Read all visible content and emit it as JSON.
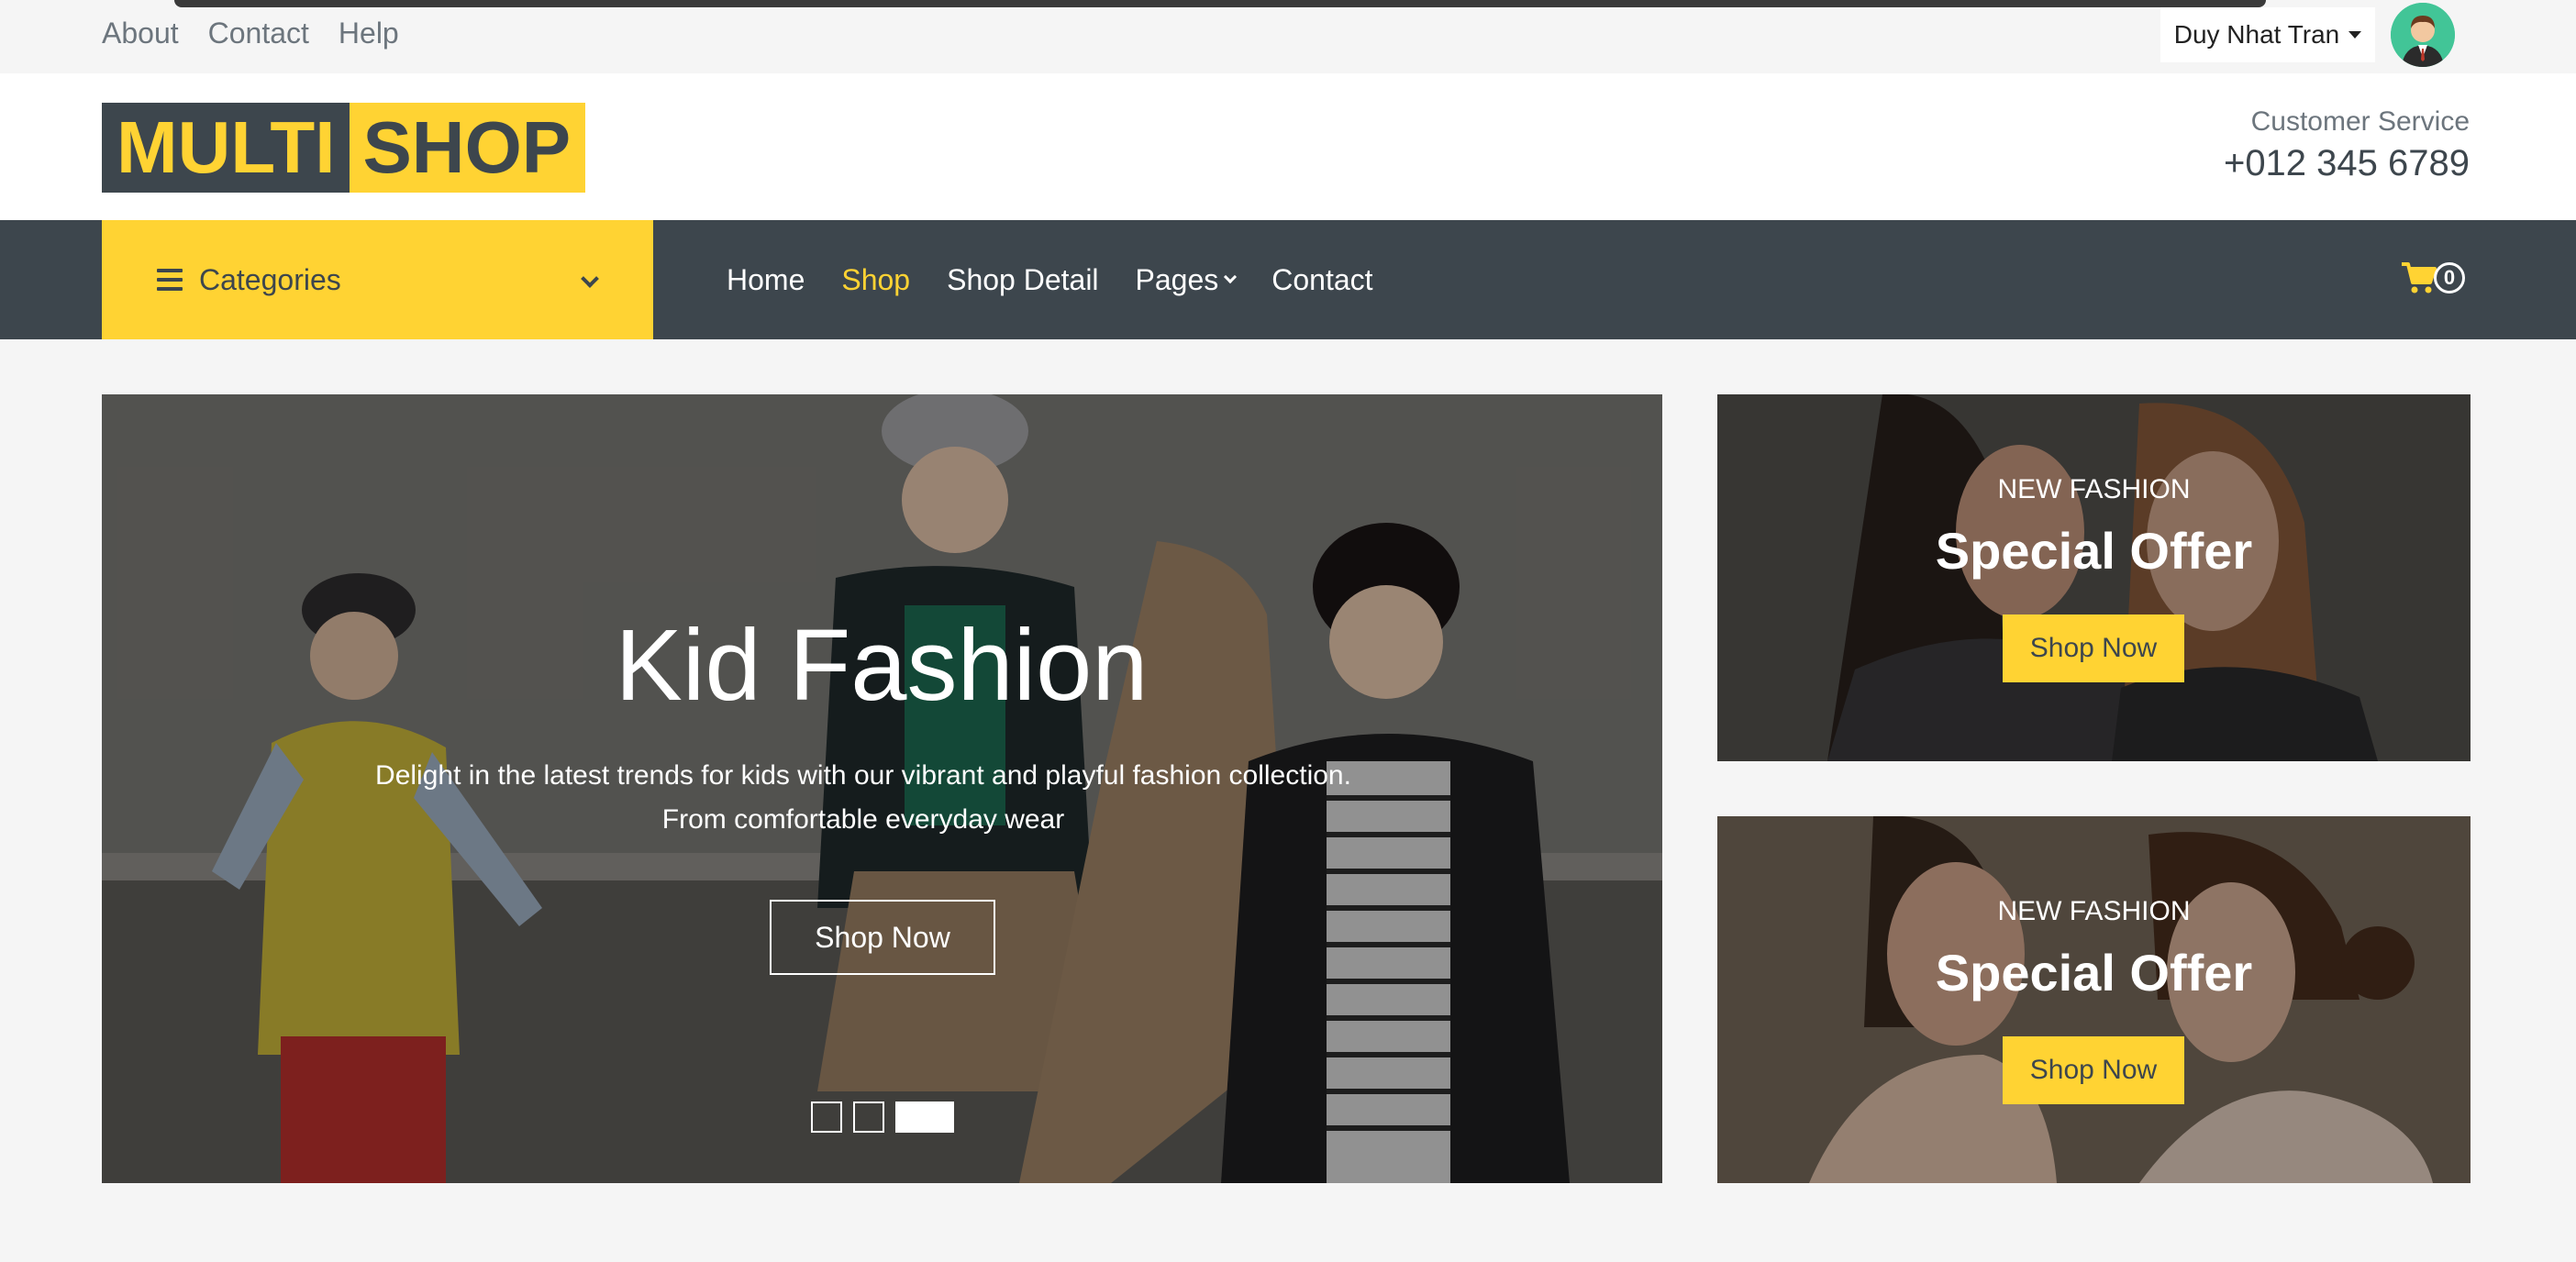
{
  "topbar": {
    "links": [
      "About",
      "Contact",
      "Help"
    ],
    "user_name": "Duy Nhat Tran"
  },
  "header": {
    "logo_part1": "MULTI",
    "logo_part2": "SHOP",
    "cs_label": "Customer Service",
    "cs_phone": "+012 345 6789"
  },
  "nav": {
    "categories_label": "Categories",
    "links": [
      "Home",
      "Shop",
      "Shop Detail",
      "Pages",
      "Contact"
    ],
    "active_link": "Shop",
    "cart_count": "0"
  },
  "carousel": {
    "title": "Kid Fashion",
    "description": "Delight in the latest trends for kids with our vibrant and playful fashion collection. From comfortable everyday wear",
    "button": "Shop Now",
    "slide_count": 3,
    "active_slide": 3
  },
  "offers": [
    {
      "kicker": "NEW FASHION",
      "title": "Special Offer",
      "button": "Shop Now"
    },
    {
      "kicker": "NEW FASHION",
      "title": "Special Offer",
      "button": "Shop Now"
    }
  ],
  "colors": {
    "brand_yellow": "#ffd333",
    "brand_dark": "#3d464d",
    "muted_text": "#6c757d"
  }
}
